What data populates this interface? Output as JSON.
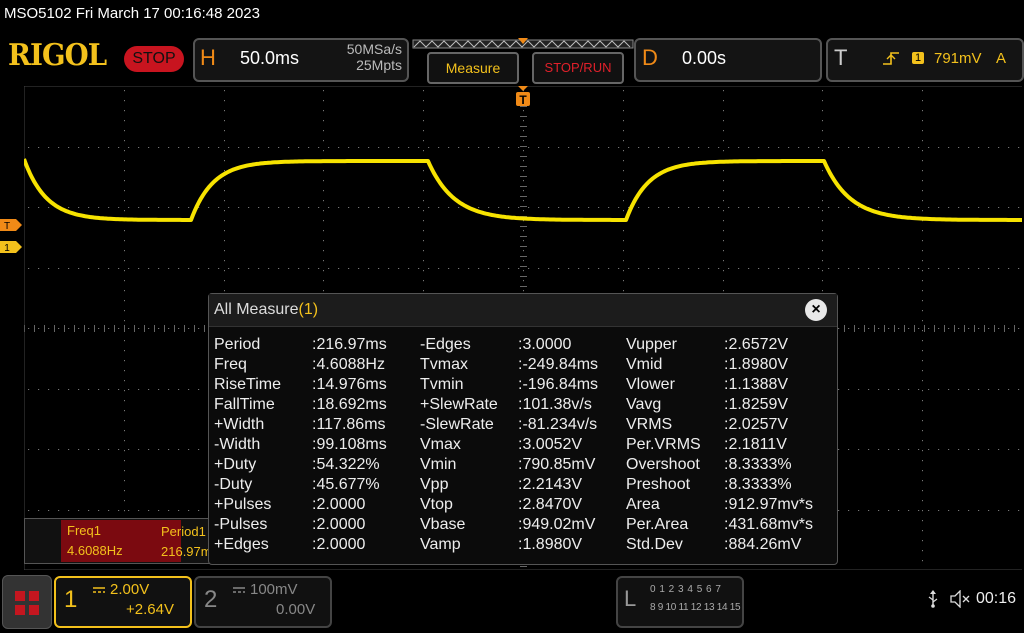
{
  "header": {
    "title": "MSO5102  Fri March 17 00:16:48 2023",
    "logo": "RIGOL",
    "status": "STOP"
  },
  "horizontal": {
    "letter": "H",
    "timebase": "50.0ms",
    "sample_rate": "50MSa/s",
    "memory_depth": "25Mpts"
  },
  "buttons": {
    "measure": "Measure",
    "stop_run": "STOP/RUN"
  },
  "delay": {
    "letter": "D",
    "value": "0.00s"
  },
  "trigger": {
    "letter": "T",
    "channel": "1",
    "level": "791mV",
    "mode": "A",
    "icon": "rising-edge-icon"
  },
  "markers": {
    "trigger": "T",
    "ch1": "1"
  },
  "panel": {
    "title": "All Measure",
    "count": "(1)",
    "close": "×",
    "col1": [
      {
        "label": "Period",
        "value": ":216.97ms"
      },
      {
        "label": "Freq",
        "value": ":4.6088Hz"
      },
      {
        "label": "RiseTime",
        "value": ":14.976ms"
      },
      {
        "label": "FallTime",
        "value": ":18.692ms"
      },
      {
        "label": "+Width",
        "value": ":117.86ms"
      },
      {
        "label": "-Width",
        "value": ":99.108ms"
      },
      {
        "label": "+Duty",
        "value": ":54.322%"
      },
      {
        "label": "-Duty",
        "value": ":45.677%"
      },
      {
        "label": "+Pulses",
        "value": ":2.0000"
      },
      {
        "label": "-Pulses",
        "value": ":2.0000"
      },
      {
        "label": "+Edges",
        "value": ":2.0000"
      }
    ],
    "col2": [
      {
        "label": "-Edges",
        "value": ":3.0000"
      },
      {
        "label": "Tvmax",
        "value": ":-249.84ms"
      },
      {
        "label": "Tvmin",
        "value": ":-196.84ms"
      },
      {
        "label": "+SlewRate",
        "value": ":101.38v/s"
      },
      {
        "label": "-SlewRate",
        "value": ":-81.234v/s"
      },
      {
        "label": "Vmax",
        "value": ":3.0052V"
      },
      {
        "label": "Vmin",
        "value": ":790.85mV"
      },
      {
        "label": "Vpp",
        "value": ":2.2143V"
      },
      {
        "label": "Vtop",
        "value": ":2.8470V"
      },
      {
        "label": "Vbase",
        "value": ":949.02mV"
      },
      {
        "label": "Vamp",
        "value": ":1.8980V"
      }
    ],
    "col3": [
      {
        "label": "Vupper",
        "value": ":2.6572V"
      },
      {
        "label": "Vmid",
        "value": ":1.8980V"
      },
      {
        "label": "Vlower",
        "value": ":1.1388V"
      },
      {
        "label": "Vavg",
        "value": ":1.8259V"
      },
      {
        "label": "VRMS",
        "value": ":2.0257V"
      },
      {
        "label": "Per.VRMS",
        "value": ":2.1811V"
      },
      {
        "label": "Overshoot",
        "value": ":8.3333%"
      },
      {
        "label": "Preshoot",
        "value": ":8.3333%"
      },
      {
        "label": "Area",
        "value": ":912.97mv*s"
      },
      {
        "label": "Per.Area",
        "value": ":431.68mv*s"
      },
      {
        "label": "Std.Dev",
        "value": ":884.26mV"
      }
    ]
  },
  "result_bar": {
    "items": [
      {
        "label": "Freq1",
        "value": "4.6088Hz"
      },
      {
        "label": "Period1",
        "value": "216.97m"
      }
    ]
  },
  "channels": {
    "ch1": {
      "number": "1",
      "scale": "2.00V",
      "offset": "+2.64V",
      "color": "#f3c11c"
    },
    "ch2": {
      "number": "2",
      "scale": "100mV",
      "offset": "0.00V",
      "color": "#888888"
    }
  },
  "logic": {
    "letter": "L",
    "row1": "0 1 2 3  4 5 6 7",
    "row2": "8 9 10 11 12 13 14 15"
  },
  "status_bar": {
    "usb_icon": "usb-icon",
    "sound_icon": "speaker-muted-icon",
    "time": "00:16"
  }
}
